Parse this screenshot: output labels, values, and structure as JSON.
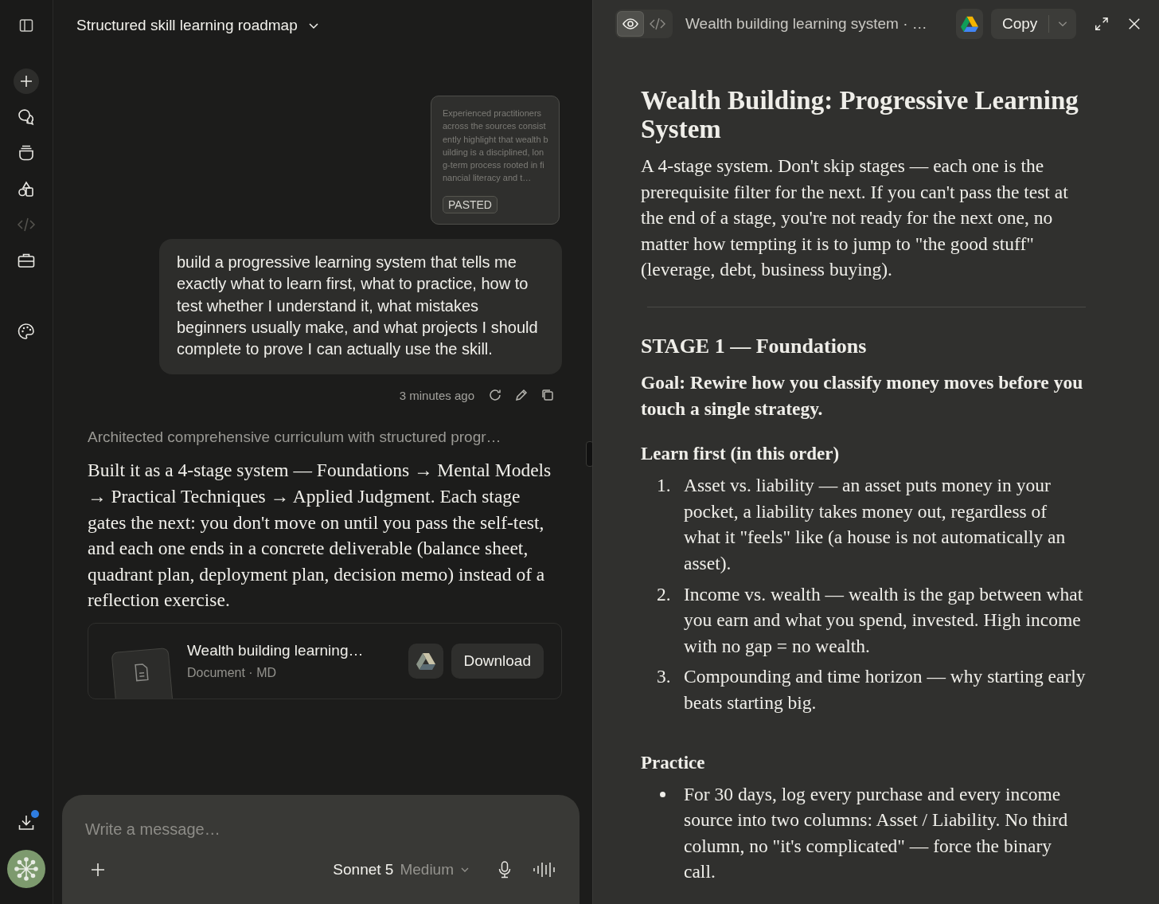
{
  "sidebar": {
    "items": [
      {
        "kind": "panel",
        "disabled": false
      },
      {
        "kind": "new",
        "disabled": false
      },
      {
        "kind": "chats",
        "disabled": false
      },
      {
        "kind": "projects",
        "disabled": false
      },
      {
        "kind": "artifacts",
        "disabled": false
      },
      {
        "kind": "code",
        "disabled": true
      },
      {
        "kind": "tools",
        "disabled": false
      },
      {
        "kind": "palette",
        "disabled": false
      }
    ],
    "downloads": {
      "badge": true
    }
  },
  "chat": {
    "title": "Structured skill learning roadmap",
    "pasted": {
      "text": "Experienced practitioners across the sources consistently highlight that wealth building is a disciplined, long-term process rooted in financial literacy and t…",
      "label": "PASTED"
    },
    "user_message": {
      "text": "build a progressive learning system that tells me exactly what to learn first, what to practice, how to test whether I understand it, what mistakes beginners usually make, and what projects I should complete to prove I can actually use the skill.",
      "time": "3 minutes ago"
    },
    "thinking": "Architected comprehensive curriculum with structured progr…",
    "reply": "Built it as a 4-stage system — Foundations → Mental Models → Practical Techniques → Applied Judgment. Each stage gates the next: you don't move on until you pass the self-test, and each one ends in a concrete deliverable (balance sheet, quadrant plan, deployment plan, decision memo) instead of a reflection exercise.",
    "file": {
      "name": "Wealth building learning…",
      "meta": "Document · MD",
      "button": "Download"
    },
    "composer": {
      "placeholder": "Write a message…",
      "model": "Sonnet 5",
      "effort": "Medium"
    }
  },
  "artifact": {
    "views": [
      {
        "kind": "preview",
        "selected": true
      },
      {
        "kind": "code",
        "selected": false
      }
    ],
    "title": "Wealth building learning system · …",
    "copy": "Copy",
    "blocks": [
      {
        "kind": "h1",
        "text": "Wealth Building: Progressive Learning System"
      },
      {
        "kind": "p",
        "text": "A 4-stage system. Don't skip stages — each one is the prerequisite filter for the next. If you can't pass the test at the end of a stage, you're not ready for the next one, no matter how tempting it is to jump to \"the good stuff\" (leverage, debt, business buying)."
      },
      {
        "kind": "rule"
      },
      {
        "kind": "h2",
        "text": "STAGE 1 — Foundations"
      },
      {
        "kind": "lead",
        "text": "Goal: Rewire how you classify money moves before you touch a single strategy."
      },
      {
        "kind": "h3",
        "text": "Learn first (in this order)"
      },
      {
        "kind": "ol",
        "items": [
          {
            "marker": "1.",
            "text": "Asset vs. liability — an asset puts money in your pocket, a liability takes money out, regardless of what it \"feels\" like (a house is not automatically an asset)."
          },
          {
            "marker": "2.",
            "text": "Income vs. wealth — wealth is the gap between what you earn and what you spend, invested. High income with no gap = no wealth."
          },
          {
            "marker": "3.",
            "text": "Compounding and time horizon — why starting early beats starting big."
          }
        ]
      },
      {
        "kind": "h3",
        "text": "Practice"
      },
      {
        "kind": "ul",
        "items": [
          {
            "text": "For 30 days, log every purchase and every income source into two columns: Asset / Liability. No third column, no \"it's complicated\" — force the binary call."
          }
        ]
      }
    ]
  }
}
